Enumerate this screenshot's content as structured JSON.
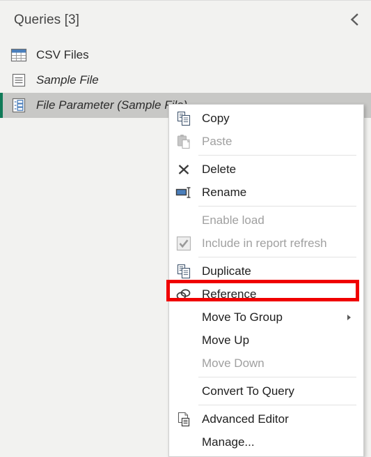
{
  "pane": {
    "title": "Queries [3]",
    "collapse_icon": "chevron-left-icon",
    "accent_color": "#107a58",
    "selected_row_bg": "#c8c8c6",
    "background": "#f2f2f0"
  },
  "queries": [
    {
      "label": "CSV Files",
      "icon": "table-icon",
      "italic": false,
      "selected": false
    },
    {
      "label": "Sample File",
      "icon": "list-icon",
      "italic": true,
      "selected": false
    },
    {
      "label": "File Parameter (Sample File)",
      "icon": "parameter-icon",
      "italic": true,
      "selected": true
    }
  ],
  "context_menu": {
    "highlight_color": "#f00000",
    "highlighted_item": "Reference",
    "items": [
      {
        "label": "Copy",
        "icon": "copy-icon",
        "disabled": false,
        "submenu": false,
        "separator_after": false
      },
      {
        "label": "Paste",
        "icon": "paste-icon",
        "disabled": true,
        "submenu": false,
        "separator_after": true
      },
      {
        "label": "Delete",
        "icon": "delete-x-icon",
        "disabled": false,
        "submenu": false,
        "separator_after": false
      },
      {
        "label": "Rename",
        "icon": "rename-icon",
        "disabled": false,
        "submenu": false,
        "separator_after": true
      },
      {
        "label": "Enable load",
        "icon": "none",
        "disabled": true,
        "submenu": false,
        "separator_after": false
      },
      {
        "label": "Include in report refresh",
        "icon": "checkbox-checked-icon",
        "disabled": true,
        "submenu": false,
        "separator_after": true
      },
      {
        "label": "Duplicate",
        "icon": "duplicate-icon",
        "disabled": false,
        "submenu": false,
        "separator_after": false
      },
      {
        "label": "Reference",
        "icon": "reference-link-icon",
        "disabled": false,
        "submenu": false,
        "separator_after": false
      },
      {
        "label": "Move To Group",
        "icon": "none",
        "disabled": false,
        "submenu": true,
        "separator_after": false
      },
      {
        "label": "Move Up",
        "icon": "none",
        "disabled": false,
        "submenu": false,
        "separator_after": false
      },
      {
        "label": "Move Down",
        "icon": "none",
        "disabled": true,
        "submenu": false,
        "separator_after": true
      },
      {
        "label": "Convert To Query",
        "icon": "none",
        "disabled": false,
        "submenu": false,
        "separator_after": true
      },
      {
        "label": "Advanced Editor",
        "icon": "advanced-editor-icon",
        "disabled": false,
        "submenu": false,
        "separator_after": false
      },
      {
        "label": "Manage...",
        "icon": "none",
        "disabled": false,
        "submenu": false,
        "separator_after": false
      }
    ]
  }
}
